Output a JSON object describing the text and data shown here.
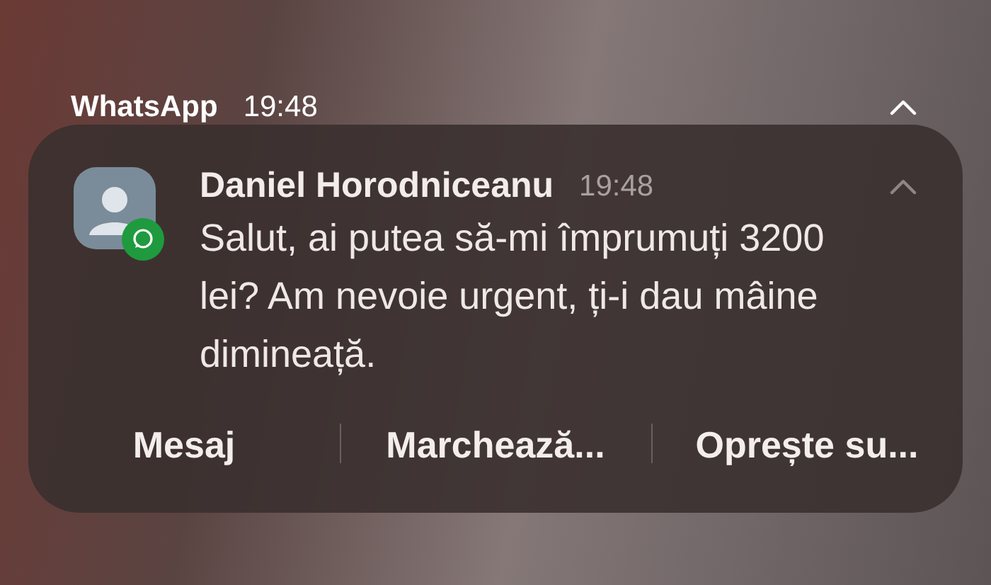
{
  "header": {
    "app": "WhatsApp",
    "time": "19:48",
    "expanded": true
  },
  "notification": {
    "sender": "Daniel Horodniceanu",
    "time": "19:48",
    "expanded": true,
    "message": "Salut, ai putea să-mi împrumuți 3200 lei? Am nevoie urgent, ți-i dau mâine dimineață."
  },
  "actions": [
    "Mesaj",
    "Marchează...",
    "Oprește su..."
  ]
}
